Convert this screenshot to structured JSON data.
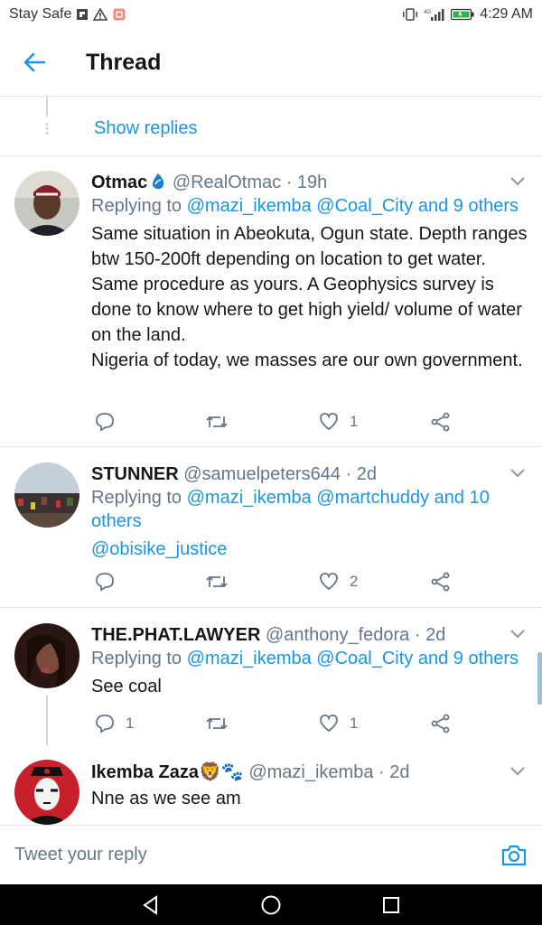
{
  "status_bar": {
    "carrier": "Stay Safe",
    "time": "4:29 AM"
  },
  "header": {
    "title": "Thread"
  },
  "thread": {
    "show_replies": "Show replies"
  },
  "tweets": [
    {
      "name": "Otmac",
      "handle": "@RealOtmac",
      "time": "· 19h",
      "replying_prefix": "Replying to",
      "replying_mentions": "@mazi_ikemba @Coal_City and 9 others",
      "text_lines": [
        "Same situation in Abeokuta, Ogun state. Depth ranges btw 150-200ft depending on location to get water. Same procedure as yours. A Geophysics survey is done to know where to get high yield/ volume of water on the land.",
        "Nigeria of today, we masses are our own government."
      ],
      "reply_count": "",
      "like_count": "1"
    },
    {
      "name": "STUNNER",
      "handle": "@samuelpeters644",
      "time": "· 2d",
      "replying_prefix": "Replying to",
      "replying_mentions": "@mazi_ikemba @martchuddy and 10 others",
      "text": "@obisike_justice",
      "reply_count": "",
      "like_count": "2"
    },
    {
      "name": "THE.PHAT.LAWYER",
      "handle": "@anthony_fedora",
      "time": "· 2d",
      "replying_prefix": "Replying to",
      "replying_mentions": "@mazi_ikemba @Coal_City and 9 others",
      "text": "See coal",
      "reply_count": "1",
      "like_count": "1"
    },
    {
      "name": "Ikemba Zaza",
      "name_emoji": "🦁🐾",
      "handle": "@mazi_ikemba",
      "time": "· 2d",
      "text": "Nne as we see am"
    }
  ],
  "composer": {
    "placeholder": "Tweet your reply"
  },
  "colors": {
    "accent": "#1b95e0",
    "text": "#14171a",
    "muted": "#657786",
    "divider": "#e1e8ed"
  }
}
